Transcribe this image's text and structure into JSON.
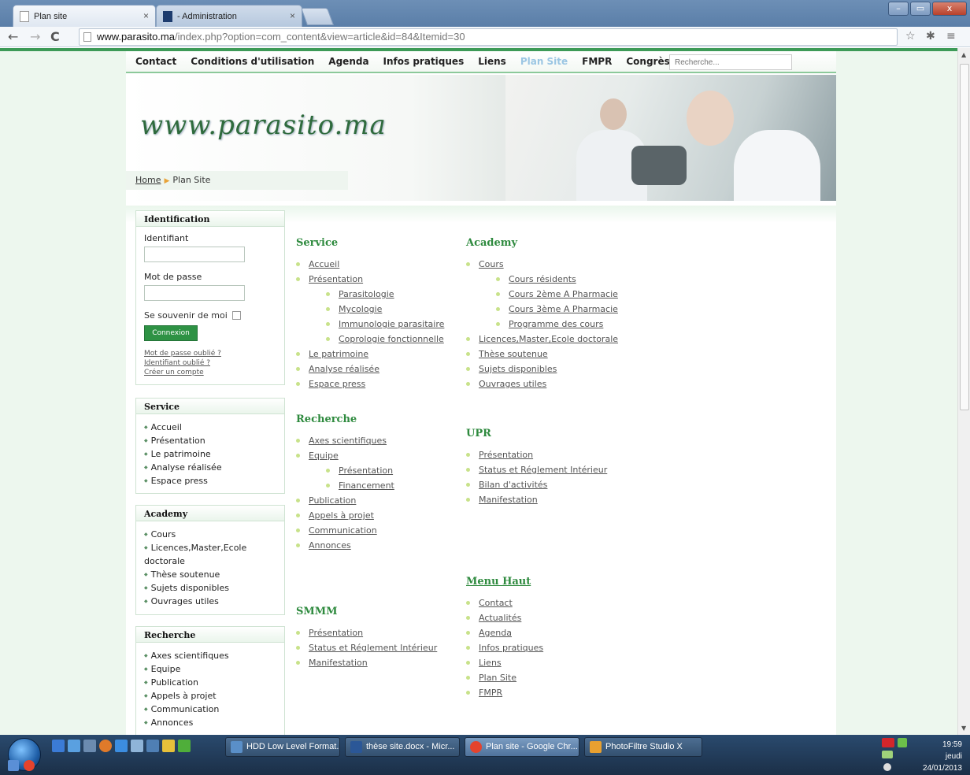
{
  "browser": {
    "tabs": [
      {
        "title": "Plan site",
        "close": "×"
      },
      {
        "title": "- Administration",
        "close": "×"
      }
    ],
    "url_host": "www.parasito.ma",
    "url_path": "/index.php?option=com_content&view=article&id=84&Itemid=30",
    "window_buttons": {
      "minimize": "–",
      "maximize": "▭",
      "close": "x"
    }
  },
  "topmenu": {
    "items": [
      "Contact",
      "Conditions d'utilisation",
      "Agenda",
      "Infos pratiques",
      "Liens",
      "Plan Site",
      "FMPR",
      "Congrès"
    ],
    "active_index": 5,
    "search_placeholder": "Recherche..."
  },
  "banner": {
    "title": "www.parasito.ma"
  },
  "breadcrumb": {
    "home": "Home",
    "current": "Plan Site"
  },
  "login": {
    "title": "Identification",
    "username_label": "Identifiant",
    "password_label": "Mot de passe",
    "remember_label": "Se souvenir de moi",
    "button": "Connexion",
    "forgot_password": "Mot de passe oublié ?",
    "forgot_username": "Identifiant oublié ?",
    "create_account": "Créer un compte"
  },
  "side_modules": [
    {
      "title": "Service",
      "items": [
        "Accueil",
        "Présentation",
        "Le patrimoine",
        "Analyse réalisée",
        "Espace press"
      ]
    },
    {
      "title": "Academy",
      "items": [
        "Cours",
        "Licences,Master,Ecole doctorale",
        "Thèse soutenue",
        "Sujets disponibles",
        "Ouvrages utiles"
      ]
    },
    {
      "title": "Recherche",
      "items": [
        "Axes scientifiques",
        "Equipe",
        "Publication",
        "Appels à projet",
        "Communication",
        "Annonces"
      ]
    }
  ],
  "sitemap": {
    "service": {
      "title": "Service",
      "items": [
        {
          "label": "Accueil",
          "level": 1
        },
        {
          "label": "Présentation",
          "level": 1
        },
        {
          "label": "Parasitologie",
          "level": 2
        },
        {
          "label": "Mycologie",
          "level": 2
        },
        {
          "label": "Immunologie parasitaire",
          "level": 2
        },
        {
          "label": "Coprologie fonctionnelle",
          "level": 2
        },
        {
          "label": "Le patrimoine",
          "level": 1
        },
        {
          "label": "Analyse réalisée",
          "level": 1
        },
        {
          "label": "Espace press",
          "level": 1
        }
      ]
    },
    "academy": {
      "title": "Academy",
      "items": [
        {
          "label": "Cours",
          "level": 1
        },
        {
          "label": "Cours résidents",
          "level": 2
        },
        {
          "label": "Cours 2ème A Pharmacie",
          "level": 2
        },
        {
          "label": "Cours 3ème A Pharmacie",
          "level": 2
        },
        {
          "label": "Programme des cours",
          "level": 2
        },
        {
          "label": "Licences,Master,Ecole doctorale",
          "level": 1
        },
        {
          "label": "Thèse soutenue",
          "level": 1
        },
        {
          "label": "Sujets disponibles",
          "level": 1
        },
        {
          "label": "Ouvrages utiles",
          "level": 1
        }
      ]
    },
    "recherche": {
      "title": "Recherche",
      "items": [
        {
          "label": "Axes scientifiques",
          "level": 1
        },
        {
          "label": "Equipe",
          "level": 1
        },
        {
          "label": "Présentation",
          "level": 2
        },
        {
          "label": "Financement",
          "level": 2
        },
        {
          "label": "Publication",
          "level": 1
        },
        {
          "label": "Appels à projet",
          "level": 1
        },
        {
          "label": "Communication",
          "level": 1
        },
        {
          "label": "Annonces",
          "level": 1
        }
      ]
    },
    "upr": {
      "title": "UPR",
      "items": [
        {
          "label": "Présentation",
          "level": 1
        },
        {
          "label": "Status et Réglement Intérieur",
          "level": 1
        },
        {
          "label": "Bilan d'activités",
          "level": 1
        },
        {
          "label": "Manifestation",
          "level": 1
        }
      ]
    },
    "menu_haut": {
      "title": "Menu Haut",
      "items": [
        {
          "label": "Contact",
          "level": 1
        },
        {
          "label": "Actualités",
          "level": 1
        },
        {
          "label": "Agenda",
          "level": 1
        },
        {
          "label": "Infos pratiques",
          "level": 1
        },
        {
          "label": "Liens",
          "level": 1
        },
        {
          "label": "Plan Site",
          "level": 1
        },
        {
          "label": "FMPR",
          "level": 1
        }
      ]
    },
    "smmm": {
      "title": "SMMM",
      "items": [
        {
          "label": "Présentation",
          "level": 1
        },
        {
          "label": "Status et Réglement Intérieur",
          "level": 1
        },
        {
          "label": "Manifestation",
          "level": 1
        }
      ]
    }
  },
  "taskbar": {
    "tasks": [
      {
        "label": "HDD Low Level Format...",
        "icon_color": "#5a8fc8"
      },
      {
        "label": "thèse site.docx - Micr...",
        "icon_color": "#2b5797"
      },
      {
        "label": "Plan site - Google Chr...",
        "icon_color": "#e5432d"
      },
      {
        "label": "PhotoFiltre Studio X",
        "icon_color": "#e8a030"
      }
    ],
    "clock_time": "19:59",
    "clock_day": "jeudi",
    "clock_date": "24/01/2013"
  },
  "colors": {
    "accent_green": "#2e8a3e",
    "page_bg": "#edf7ee"
  }
}
